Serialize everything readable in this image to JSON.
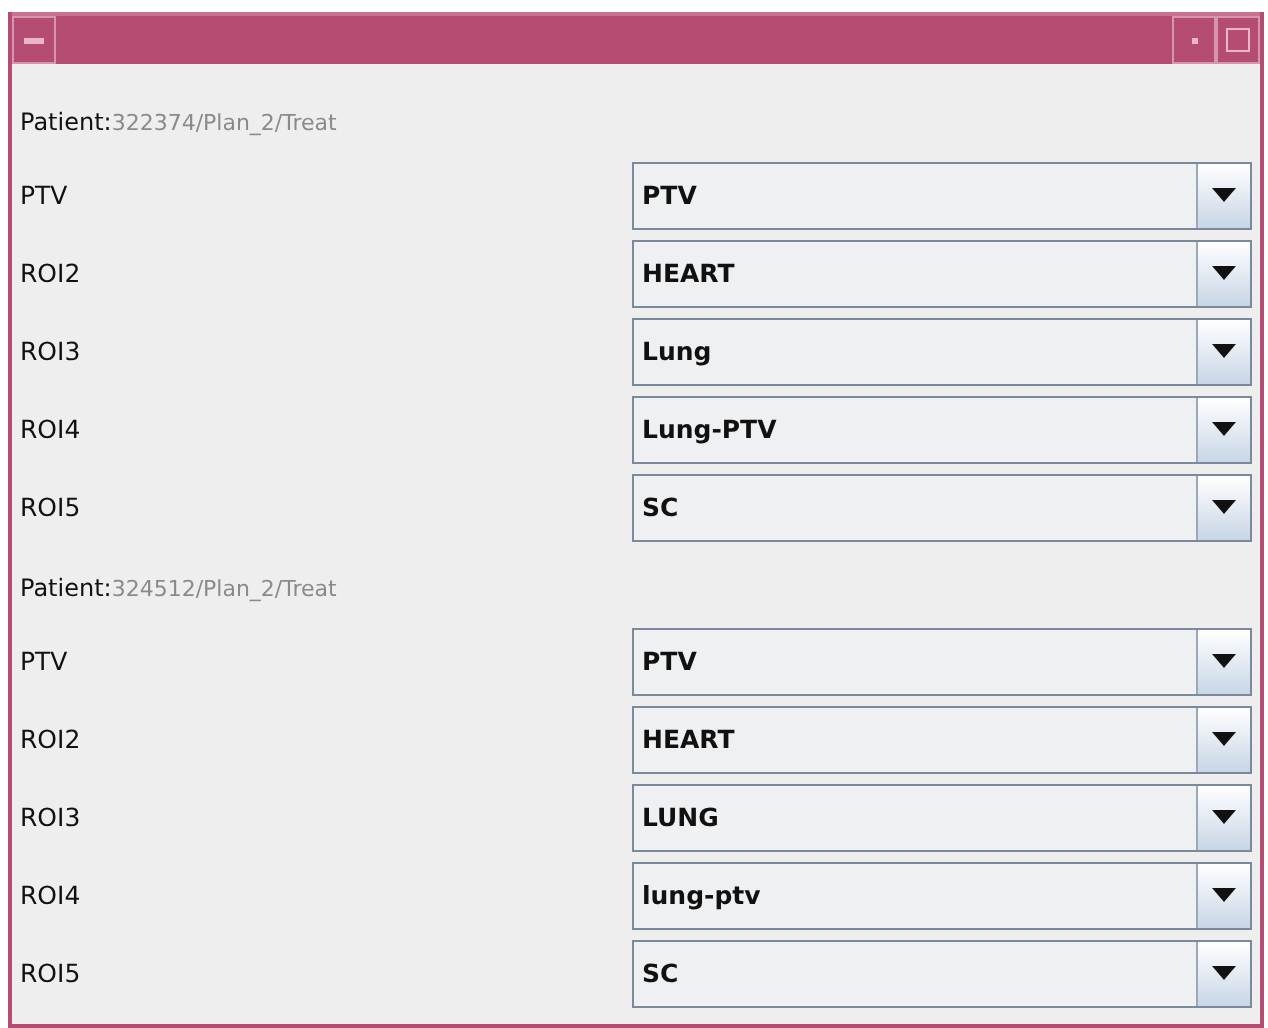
{
  "groups": [
    {
      "label": "Patient:",
      "patient": "322374/Plan_2/Treat",
      "rows": [
        {
          "name": "PTV",
          "value": "PTV"
        },
        {
          "name": "ROI2",
          "value": "HEART"
        },
        {
          "name": "ROI3",
          "value": "Lung"
        },
        {
          "name": "ROI4",
          "value": "Lung-PTV"
        },
        {
          "name": "ROI5",
          "value": "SC"
        }
      ]
    },
    {
      "label": "Patient:",
      "patient": "324512/Plan_2/Treat",
      "rows": [
        {
          "name": "PTV",
          "value": "PTV"
        },
        {
          "name": "ROI2",
          "value": "HEART"
        },
        {
          "name": "ROI3",
          "value": "LUNG"
        },
        {
          "name": "ROI4",
          "value": "lung-ptv"
        },
        {
          "name": "ROI5",
          "value": "SC"
        }
      ]
    }
  ]
}
